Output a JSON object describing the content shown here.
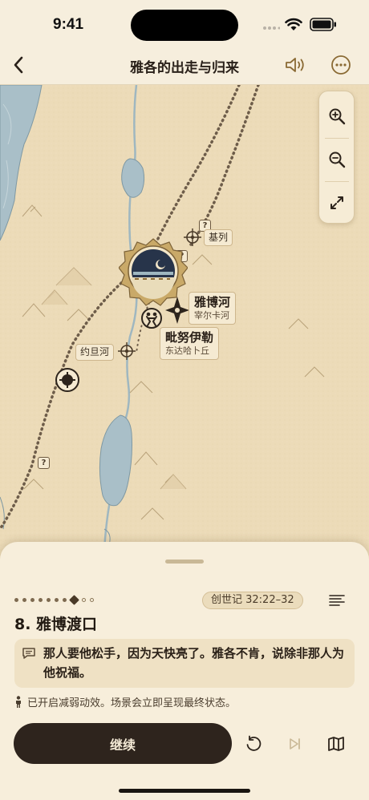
{
  "status_bar": {
    "time": "9:41"
  },
  "nav": {
    "title": "雅各的出走与归来",
    "back_icon": "chevron-left-icon",
    "audio_icon": "speaker-icon",
    "more_icon": "ellipsis-circle-icon"
  },
  "map": {
    "controls": {
      "zoom_in_icon": "zoom-in-icon",
      "zoom_out_icon": "zoom-out-icon",
      "fullscreen_icon": "expand-icon"
    },
    "places": [
      {
        "id": "gilead",
        "name": "基列"
      },
      {
        "id": "jabbok",
        "name": "雅博河",
        "sub": "宰尔卡河"
      },
      {
        "id": "penuel",
        "name": "毗努伊勒",
        "sub": "东达哈卜丘"
      },
      {
        "id": "jordan",
        "name": "约旦河"
      }
    ],
    "unknown_marker": "?",
    "colors": {
      "parchment": "#ecdbb8",
      "water": "#a9bfc8",
      "route": "#6e5d4a",
      "scene_dark": "#27344a"
    }
  },
  "sheet": {
    "progress": {
      "total": 10,
      "current_index": 7
    },
    "reference": "创世记 32:22–32",
    "scene_title": "8. 雅博渡口",
    "quote": "那人要他松手，因为天快亮了。雅各不肯，说除非那人为他祝福。",
    "reduced_motion_note": "已开启减弱动效。场景会立即呈现最终状态。",
    "continue_label": "继续",
    "controls": {
      "replay_icon": "replay-icon",
      "skip_icon": "skip-forward-icon",
      "map_icon": "map-icon"
    }
  }
}
